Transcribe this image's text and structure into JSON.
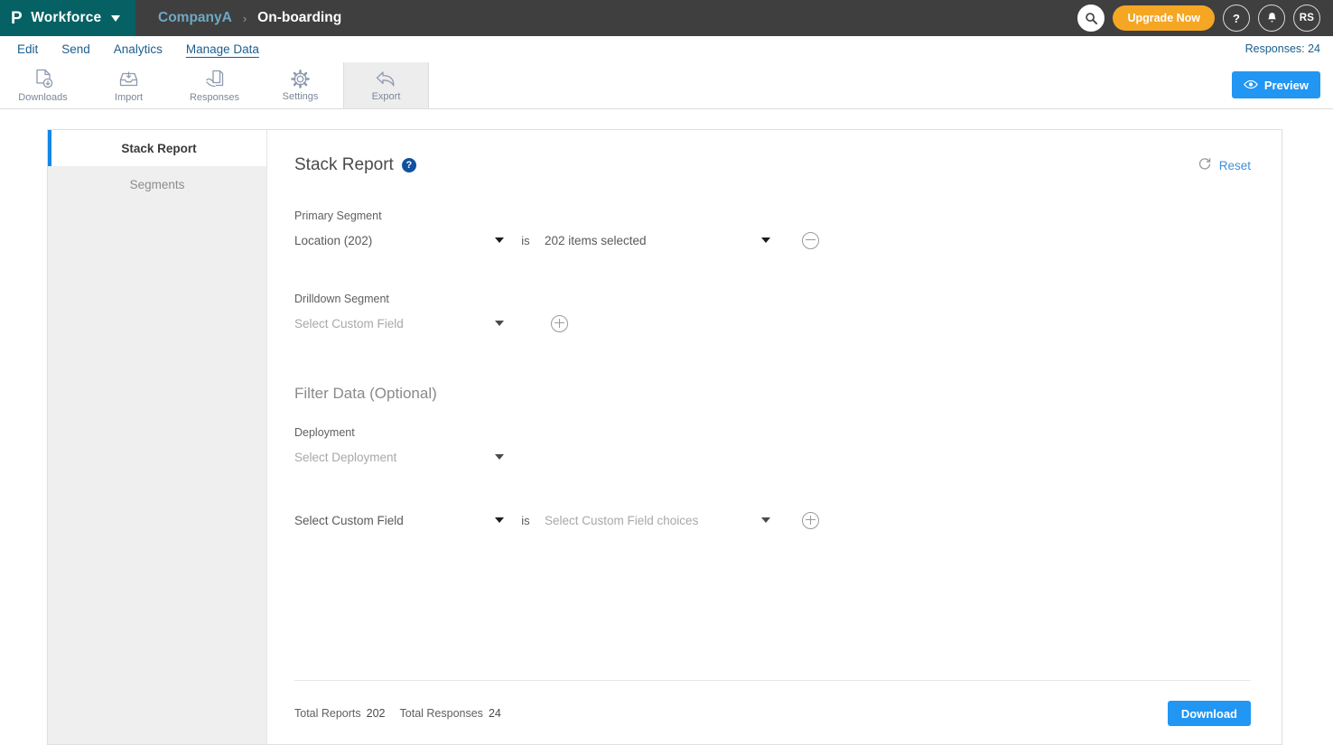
{
  "topbar": {
    "logo_glyph": "P",
    "product": "Workforce",
    "breadcrumb_company": "CompanyA",
    "breadcrumb_separator": "›",
    "breadcrumb_current": "On-boarding",
    "search_icon": "search-icon",
    "upgrade_label": "Upgrade Now",
    "help_label": "?",
    "bell_icon": "bell-icon",
    "avatar_initials": "RS"
  },
  "nav": {
    "items": [
      {
        "label": "Edit",
        "active": false
      },
      {
        "label": "Send",
        "active": false
      },
      {
        "label": "Analytics",
        "active": false
      },
      {
        "label": "Manage Data",
        "active": true
      }
    ],
    "responses_label": "Responses: 24"
  },
  "toolstrip": {
    "tools": [
      {
        "label": "Downloads",
        "icon": "download-document-icon",
        "active": false
      },
      {
        "label": "Import",
        "icon": "import-tray-icon",
        "active": false
      },
      {
        "label": "Responses",
        "icon": "responses-hand-document-icon",
        "active": false
      },
      {
        "label": "Settings",
        "icon": "gear-icon",
        "active": false
      },
      {
        "label": "Export",
        "icon": "export-arrow-icon",
        "active": true
      }
    ],
    "preview_label": "Preview",
    "preview_icon": "eye-icon"
  },
  "sidebar": {
    "items": [
      {
        "label": "Stack Report",
        "active": true
      },
      {
        "label": "Segments",
        "active": false
      }
    ]
  },
  "main": {
    "title": "Stack Report",
    "help_badge": "?",
    "reset_label": "Reset",
    "reset_icon": "refresh-icon",
    "primary_segment": {
      "label": "Primary Segment",
      "field_value": "Location (202)",
      "operator": "is",
      "values_value": "202 items selected",
      "remove_icon": "minus-circle-icon"
    },
    "drilldown_segment": {
      "label": "Drilldown Segment",
      "field_placeholder": "Select Custom Field",
      "add_icon": "plus-circle-icon"
    },
    "filter": {
      "section_title": "Filter Data (Optional)",
      "deployment_label": "Deployment",
      "deployment_placeholder": "Select Deployment",
      "custom_field_value": "Select Custom Field",
      "operator": "is",
      "choices_placeholder": "Select Custom Field choices",
      "add_icon": "plus-circle-icon"
    },
    "footer": {
      "total_reports_label": "Total Reports",
      "total_reports_value": "202",
      "total_responses_label": "Total Responses",
      "total_responses_value": "24",
      "download_label": "Download"
    }
  },
  "colors": {
    "brand_teal": "#056163",
    "topbar_gray": "#3f3f3f",
    "accent_blue": "#2196f3",
    "link_blue": "#1b5e8e",
    "upgrade_orange": "#f5a623",
    "active_sidebar_border": "#1287e8"
  }
}
